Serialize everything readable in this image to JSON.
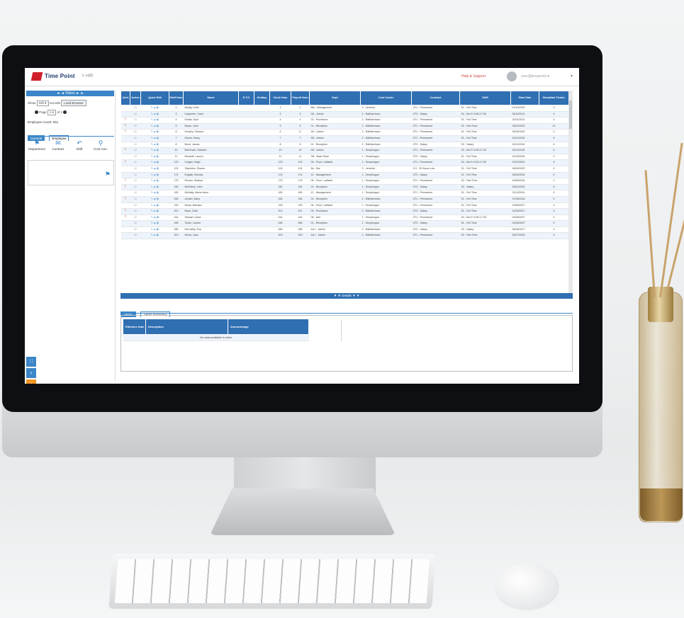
{
  "header": {
    "brand": "Time Point",
    "crumb": "> HR",
    "help": "Help & Support",
    "user": "user@timepoint.ie"
  },
  "left_panel": {
    "filters_title": "◄ ◄ Filters ► ►",
    "show_label": "Show",
    "show_value": "100 ▾",
    "records_label": "records",
    "load_button": "Load Browser",
    "page_label": "Page",
    "page_value": "1 ▾",
    "page_of": "of 1",
    "employee_count": "Employee Count: 061",
    "tabs": [
      "General",
      "Employee"
    ],
    "tools": [
      "Department",
      "Contract",
      "Shift",
      "Cost Cen."
    ]
  },
  "grid": {
    "columns": [
      "Alert",
      "Active",
      "Quick Edit",
      "Staff Num",
      "Name",
      "E.T.O",
      "Holiday",
      "Clock Num",
      "Payroll Num",
      "Dept",
      "Cost Center",
      "Contract",
      "Shift",
      "Start Date",
      "Breakfast Tender"
    ],
    "rows": [
      [
        "",
        "2",
        "Beatty, Keith",
        "",
        "",
        "1",
        "1",
        "BM - Management",
        "3 - Limerick",
        "CF1 - Permanent",
        "S1 - Full Time",
        "01/10/2020",
        "X"
      ],
      [
        "",
        "3",
        "Carpenter, Carol",
        "",
        "",
        "3",
        "3",
        "AD - Admin",
        "2 - Rathfarnham",
        "CF3 - Salary",
        "S4 - Mo-Fr 8:30-17:30",
        "06/11/2019",
        "X"
      ],
      [
        "!",
        "4",
        "Dodds, Kyle",
        "",
        "",
        "4",
        "4",
        "03 - Provisions",
        "2 - Rathfarnham",
        "CF1 - Permanent",
        "S1 - Full Time",
        "22/01/2021",
        "X"
      ],
      [
        "!",
        "5",
        "Bryan, John",
        "",
        "",
        "5",
        "5",
        "01 - Reception",
        "2 - Rathfarnham",
        "CF1 - Permanent",
        "S2 - Part Time",
        "04/01/2020",
        "X1"
      ],
      [
        "!",
        "6",
        "Dunphy, Shauna",
        "",
        "",
        "6",
        "6",
        "AD - Admin",
        "2 - Rathfarnham",
        "CF1 - Permanent",
        "S1 - Full Time",
        "04/04/2020",
        "X"
      ],
      [
        "",
        "7",
        "Guerin, Barry",
        "",
        "",
        "7",
        "7",
        "AD - Admin",
        "2 - Rathfarnham",
        "CF1 - Permanent",
        "S1 - Full Time",
        "15/11/2016",
        "X"
      ],
      [
        "",
        "8",
        "Bond, James",
        "",
        "",
        "8",
        "8",
        "01 - Reception",
        "2 - Rathfarnham",
        "CF3 - Salary",
        "S3 - Salary",
        "15/11/2016",
        "X"
      ],
      [
        "!",
        "10",
        "McKenzie, Siobhan",
        "",
        "",
        "10",
        "10",
        "AD - Admin",
        "1 - Templeogue",
        "CF1 - Permanent",
        "S4 - Mo-Fr 8:30-17:30",
        "15/11/2016",
        "X"
      ],
      [
        "",
        "11",
        "Newbolt, Lauren",
        "",
        "",
        "11",
        "11",
        "SB - Back Store",
        "1 - Templeogue",
        "CF3 - Salary",
        "S1 - Full Time",
        "01/03/2004",
        "X"
      ],
      [
        "!",
        "123",
        "Colgan, Hugh",
        "",
        "",
        "123",
        "123",
        "06 - Floor / unlisted",
        "1 - Templeogue",
        "CF1 - Permanent",
        "S4 - Mo-Fr 8:30-17:30",
        "01/01/2001",
        "X"
      ],
      [
        "",
        "124",
        "Stapleton, Sharon",
        "",
        "",
        "124",
        "124",
        "Bu - Bar",
        "3 - Limerick",
        "CH - 20 Hours Low",
        "S1 - Full Time",
        "18/04/2020",
        "X"
      ],
      [
        "",
        "174",
        "English, Brenda",
        "",
        "",
        "174",
        "174",
        "12 - Management",
        "1 - Templeogue",
        "CF3 - Salary",
        "S1 - Full Time",
        "05/05/2004",
        "X"
      ],
      [
        "!",
        "175",
        "Rimum, Martina",
        "",
        "",
        "175",
        "175",
        "06 - Floor / unlisted",
        "1 - Templeogue",
        "CF1 - Permanent",
        "S2 - Part Time",
        "15/06/2004",
        "X"
      ],
      [
        "!",
        "182",
        "McShane, John",
        "",
        "",
        "182",
        "182",
        "01 - Reception",
        "1 - Templeogue",
        "CF3 - Salary",
        "S3 - Salary",
        "25/01/2020",
        "X"
      ],
      [
        "",
        "183",
        "McNally, Name-Anne",
        "",
        "",
        "183",
        "183",
        "12 - Management",
        "1 - Templeogue",
        "CF1 - Permanent",
        "S1 - Full Time",
        "01/11/2004",
        "X"
      ],
      [
        "!",
        "184",
        "Jordan, Barry",
        "",
        "",
        "184",
        "184",
        "01 - Reception",
        "2 - Rathfarnham",
        "CF1 - Permanent",
        "S1 - Full Time",
        "27/06/2018",
        "X"
      ],
      [
        "",
        "193",
        "Nolan, Barbara",
        "",
        "",
        "193",
        "193",
        "06 - Floor / unlisted",
        "1 - Templeogue",
        "CF1 - Permanent",
        "S1 - Full Time",
        "23/05/2007",
        "X"
      ],
      [
        "!",
        "201",
        "Ryan, Colin",
        "",
        "",
        "201",
        "201",
        "03 - Provisions",
        "2 - Rathfarnham",
        "CF3 - Salary",
        "S1 - Full Time",
        "01/05/2017",
        "X"
      ],
      [
        "!",
        "244",
        "Stewart, Ciara",
        "",
        "",
        "244",
        "244",
        "08 - Deli",
        "1 - Templeogue",
        "CF1 - Permanent",
        "S4 - Mo-Fr 8:30-17:30",
        "04/05/2007",
        "X"
      ],
      [
        "",
        "265",
        "Tower, Lauren",
        "",
        "",
        "265",
        "265",
        "01 - Reception",
        "1 - Templeogue",
        "CF3 - Salary",
        "S1 - Full Time",
        "01/05/2007",
        "X"
      ],
      [
        "",
        "285",
        "McCarthy, Eva",
        "",
        "",
        "285",
        "285",
        "Ad 1 - Admin",
        "2 - Rathfarnham",
        "CF3 - Salary",
        "S3 - Salary",
        "06/05/2017",
        "X"
      ],
      [
        "",
        "323",
        "Wood, Joan",
        "",
        "",
        "323",
        "323",
        "Ad 1 - Admin",
        "2 - Rathfarnham",
        "CF1 - Permanent",
        "S2 - Part Time",
        "25/07/2016",
        "X"
      ]
    ],
    "details_label": "▼ ▼ Details ▼ ▼"
  },
  "bottom": {
    "tabs": [
      "Alerts",
      "Alerts Summary"
    ],
    "columns": [
      "Effective Date",
      "Description",
      "Acknowledge"
    ],
    "empty": "No data available in table"
  }
}
